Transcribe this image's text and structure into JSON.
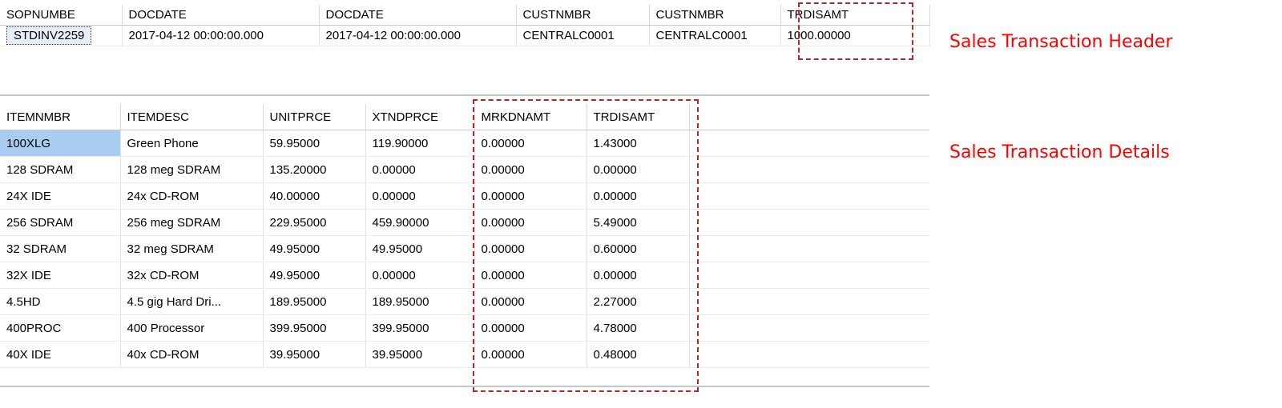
{
  "header_table": {
    "columns": [
      "SOPNUMBE",
      "DOCDATE",
      "DOCDATE",
      "CUSTNMBR",
      "CUSTNMBR",
      "TRDISAMT"
    ],
    "row": [
      "STDINV2259",
      "2017-04-12 00:00:00.000",
      "2017-04-12 00:00:00.000",
      "CENTRALC0001",
      "CENTRALC0001",
      "1000.00000"
    ]
  },
  "details_table": {
    "columns": [
      "ITEMNMBR",
      "ITEMDESC",
      "UNITPRCE",
      "XTNDPRCE",
      "MRKDNAMT",
      "TRDISAMT"
    ],
    "rows": [
      [
        "100XLG",
        "Green Phone",
        "59.95000",
        "119.90000",
        "0.00000",
        "1.43000"
      ],
      [
        "128 SDRAM",
        "128 meg SDRAM",
        "135.20000",
        "0.00000",
        "0.00000",
        "0.00000"
      ],
      [
        "24X IDE",
        "24x CD-ROM",
        "40.00000",
        "0.00000",
        "0.00000",
        "0.00000"
      ],
      [
        "256 SDRAM",
        "256 meg SDRAM",
        "229.95000",
        "459.90000",
        "0.00000",
        "5.49000"
      ],
      [
        "32 SDRAM",
        "32 meg SDRAM",
        "49.95000",
        "49.95000",
        "0.00000",
        "0.60000"
      ],
      [
        "32X IDE",
        "32x CD-ROM",
        "49.95000",
        "0.00000",
        "0.00000",
        "0.00000"
      ],
      [
        "4.5HD",
        "4.5 gig Hard Dri...",
        "189.95000",
        "189.95000",
        "0.00000",
        "2.27000"
      ],
      [
        "400PROC",
        "400 Processor",
        "399.95000",
        "399.95000",
        "0.00000",
        "4.78000"
      ],
      [
        "40X IDE",
        "40x CD-ROM",
        "39.95000",
        "39.95000",
        "0.00000",
        "0.48000"
      ]
    ]
  },
  "annotations": {
    "header_caption": "Sales Transaction Header",
    "details_caption": "Sales Transaction Details"
  },
  "colors": {
    "annotation_text": "#ff0000",
    "annotation_box": "#b02a2a",
    "selected_cell": "#a9cdf0"
  }
}
